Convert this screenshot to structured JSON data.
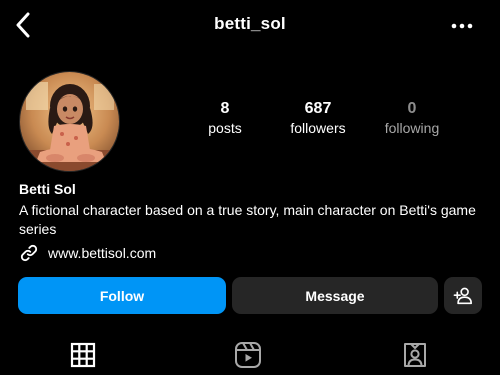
{
  "header": {
    "username": "betti_sol",
    "back_icon": "chevron-left-icon",
    "more_icon": "more-horizontal-icon"
  },
  "profile": {
    "avatar": "profile-avatar",
    "stats": [
      {
        "value": "8",
        "label": "posts"
      },
      {
        "value": "687",
        "label": "followers"
      },
      {
        "value": "0",
        "label": "following"
      }
    ],
    "name": "Betti Sol",
    "bio": "A fictional character based on a true story, main character on Betti's game series",
    "link": "www.bettisol.com",
    "link_icon": "link-icon"
  },
  "actions": {
    "follow_label": "Follow",
    "message_label": "Message",
    "add_user_icon": "add-user-icon"
  },
  "tabs": [
    {
      "icon": "grid-icon"
    },
    {
      "icon": "reels-icon"
    },
    {
      "icon": "tagged-icon"
    }
  ],
  "colors": {
    "background": "#000000",
    "primary": "#0095f6",
    "secondary_button": "#262626",
    "muted_text": "#a8a8a8"
  }
}
